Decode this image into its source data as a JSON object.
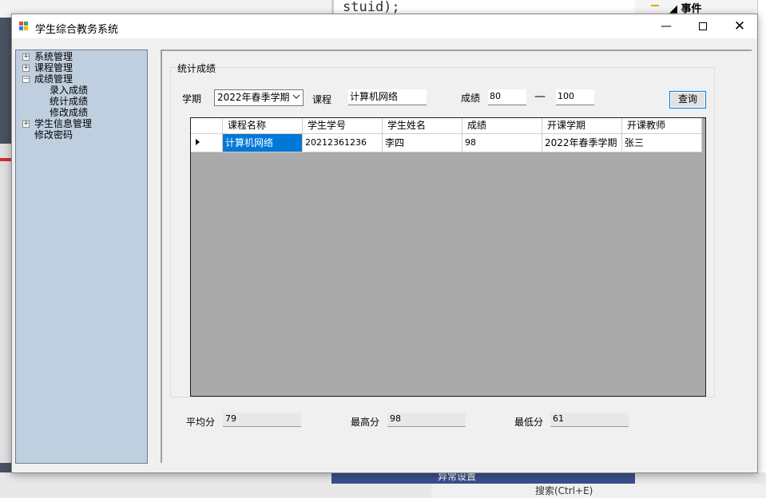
{
  "background": {
    "code_snippet": "stuid);",
    "props_header": "事件",
    "bottom_panel_title": "异常设置",
    "bottom_search_placeholder": "搜索(Ctrl+E)"
  },
  "window": {
    "title": "学生综合教务系统",
    "minimize": "—",
    "close": "✕"
  },
  "tree": {
    "nodes": [
      {
        "label": "系统管理",
        "expander": "+"
      },
      {
        "label": "课程管理",
        "expander": "+"
      },
      {
        "label": "成绩管理",
        "expander": "−",
        "children": [
          "录入成绩",
          "统计成绩",
          "修改成绩"
        ]
      },
      {
        "label": "学生信息管理",
        "expander": "+"
      },
      {
        "label": "修改密码"
      }
    ]
  },
  "stats_form": {
    "group_title": "统计成绩",
    "term_label": "学期",
    "term_value": "2022年春季学期",
    "course_label": "课程",
    "course_value": "计算机网络",
    "score_label": "成绩",
    "score_min": "80",
    "score_sep": "—",
    "score_max": "100",
    "query_button": "查询"
  },
  "grid": {
    "columns": [
      "课程名称",
      "学生学号",
      "学生姓名",
      "成绩",
      "开课学期",
      "开课教师"
    ],
    "rows": [
      [
        "计算机网络",
        "20212361236",
        "李四",
        "98",
        "2022年春季学期",
        "张三"
      ]
    ]
  },
  "summary": {
    "avg_label": "平均分",
    "avg_value": "79",
    "max_label": "最高分",
    "max_value": "98",
    "min_label": "最低分",
    "min_value": "61"
  },
  "colors": {
    "tree_bg": "#bfcfdf",
    "selection": "#0078d7",
    "grid_empty": "#aaaaaa"
  }
}
